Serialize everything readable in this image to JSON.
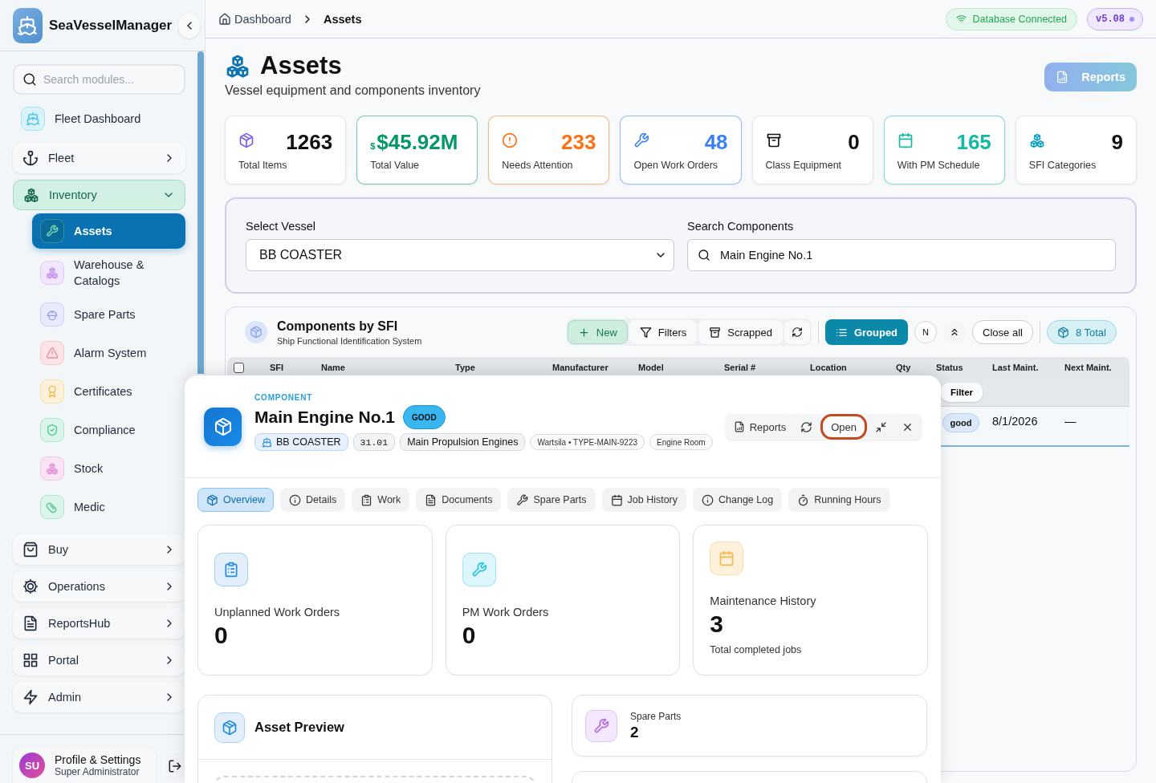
{
  "sidebar": {
    "brand": "SeaVesselManager",
    "search": {
      "placeholder": "Search modules..."
    },
    "items": [
      {
        "label": "Fleet Dashboard",
        "kind": "link"
      },
      {
        "label": "Fleet",
        "kind": "group",
        "expanded": false,
        "selected": false
      },
      {
        "label": "Inventory",
        "kind": "group",
        "expanded": true,
        "selected": true,
        "children": [
          {
            "label": "Assets",
            "selected": true
          },
          {
            "label": "Warehouse & Catalogs",
            "selected": false
          },
          {
            "label": "Spare Parts",
            "selected": false
          },
          {
            "label": "Alarm System",
            "selected": false
          },
          {
            "label": "Certificates",
            "selected": false
          },
          {
            "label": "Compliance",
            "selected": false
          },
          {
            "label": "Stock",
            "selected": false
          },
          {
            "label": "Medic",
            "selected": false
          }
        ]
      },
      {
        "label": "Buy",
        "kind": "group",
        "expanded": false,
        "selected": false
      },
      {
        "label": "Operations",
        "kind": "group",
        "expanded": false,
        "selected": false
      },
      {
        "label": "ReportsHub",
        "kind": "group",
        "expanded": false,
        "selected": false
      },
      {
        "label": "Portal",
        "kind": "group",
        "expanded": false,
        "selected": false
      },
      {
        "label": "Admin",
        "kind": "group",
        "expanded": false,
        "selected": false
      }
    ],
    "profile": {
      "initials": "SU",
      "name": "Profile & Settings",
      "role": "Super Administrator"
    }
  },
  "breadcrumbs": [
    {
      "label": "Dashboard",
      "selected": false
    },
    {
      "label": "Assets",
      "selected": true
    }
  ],
  "status": {
    "connection": "Database Connected",
    "version": "v5.08"
  },
  "page": {
    "title": "Assets",
    "subtitle": "Vessel equipment and components inventory",
    "action": "Reports"
  },
  "stats": [
    {
      "value": "1263",
      "label": "Total Items",
      "color": "#111111"
    },
    {
      "prefix": "$",
      "value": "$45.92M",
      "label": "Total Value",
      "color": "#059669"
    },
    {
      "value": "233",
      "label": "Needs Attention",
      "color": "#f97316"
    },
    {
      "value": "48",
      "label": "Open Work Orders",
      "color": "#3b82f6"
    },
    {
      "value": "0",
      "label": "Class Equipment",
      "color": "#111111"
    },
    {
      "value": "165",
      "label": "With PM Schedule",
      "color": "#14b8a6"
    },
    {
      "value": "9",
      "label": "SFI Categories",
      "color": "#111111"
    }
  ],
  "filters": {
    "vessel_label": "Select Vessel",
    "vessel_value": "BB COASTER",
    "search_label": "Search Components",
    "search_value": "Main Engine No.1"
  },
  "components": {
    "title": "Components by SFI",
    "subtitle": "Ship Functional Identification System",
    "toolbar": [
      {
        "label": "New",
        "kind": "soft"
      },
      {
        "label": "Filters",
        "kind": "plain"
      },
      {
        "label": "Scrapped",
        "kind": "plain"
      },
      {
        "kind": "icon"
      },
      {
        "label": "Grouped",
        "kind": "toggle",
        "selected": true
      },
      {
        "label": "N",
        "kind": "round"
      },
      {
        "kind": "round-icon"
      },
      {
        "label": "Close all",
        "kind": "outline"
      },
      {
        "label": "8 Total",
        "kind": "pill"
      }
    ],
    "select_all": {
      "checked": false
    },
    "columns": [
      "SFI",
      "Name",
      "Type",
      "Manufacturer",
      "Model",
      "Serial #",
      "Location",
      "Qty",
      "Status",
      "Last Maint.",
      "Next Maint."
    ],
    "filter_row": {
      "status": "Filter"
    },
    "rows": [
      {
        "status": "good",
        "last_maint": "8/1/2026",
        "next_maint": "—"
      }
    ]
  },
  "detail": {
    "label": "COMPONENT",
    "title": "Main Engine No.1",
    "condition": "GOOD",
    "tags": [
      {
        "text": "BB COASTER",
        "kind": "vessel"
      },
      {
        "text": "31.01",
        "kind": "code"
      },
      {
        "text": "Main Propulsion Engines",
        "kind": "category"
      },
      {
        "text": "Wartsila • TYPE-MAIN-9223",
        "kind": "small"
      },
      {
        "text": "Engine Room",
        "kind": "small"
      }
    ],
    "actions": [
      {
        "label": "Reports",
        "kind": "text",
        "focused": false
      },
      {
        "kind": "refresh",
        "focused": false
      },
      {
        "label": "Open",
        "kind": "text",
        "focused": true
      },
      {
        "kind": "minimize",
        "focused": false
      },
      {
        "kind": "close",
        "focused": false
      }
    ],
    "tabs": [
      {
        "label": "Overview",
        "selected": true
      },
      {
        "label": "Details",
        "selected": false
      },
      {
        "label": "Work",
        "selected": false
      },
      {
        "label": "Documents",
        "selected": false
      },
      {
        "label": "Spare Parts",
        "selected": false
      },
      {
        "label": "Job History",
        "selected": false
      },
      {
        "label": "Change Log",
        "selected": false
      },
      {
        "label": "Running Hours",
        "selected": false
      }
    ],
    "metrics": [
      {
        "label": "Unplanned Work Orders",
        "value": "0"
      },
      {
        "label": "PM Work Orders",
        "value": "0"
      },
      {
        "label": "Maintenance History",
        "value": "3",
        "note": "Total completed jobs"
      }
    ],
    "preview": {
      "title": "Asset Preview"
    },
    "spare_parts": {
      "label": "Spare Parts",
      "value": "2"
    }
  }
}
